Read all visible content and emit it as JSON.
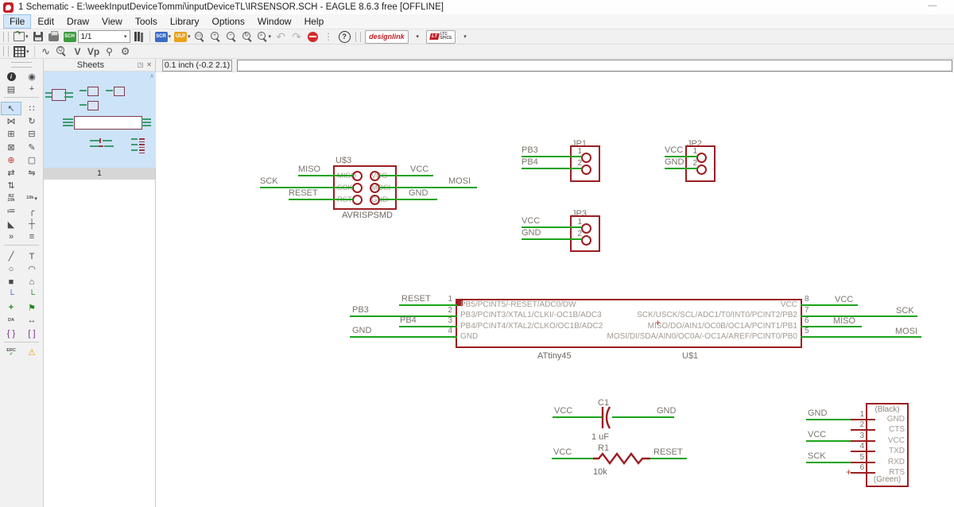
{
  "titlebar": {
    "title": "1 Schematic - E:\\weekInputDeviceTommi\\inputDeviceTL\\IRSENSOR.SCH - EAGLE 8.6.3 free [OFFLINE]",
    "minimize_glyph": "—"
  },
  "menubar": {
    "items": [
      "File",
      "Edit",
      "Draw",
      "View",
      "Tools",
      "Library",
      "Options",
      "Window",
      "Help"
    ],
    "active_item": "File"
  },
  "toolbar_main": {
    "page_selector": "1/1",
    "sch_badge": "SCH",
    "scr_badge": "SCR",
    "ulp_badge": "ULP",
    "help_glyph": "?",
    "designlink_label": "designlink",
    "ltspice_logo": "LT",
    "ltspice_line1": "LTC",
    "ltspice_line2": "SPICE"
  },
  "toolbar_view": {
    "v_label": "V",
    "vp_label": "Vp"
  },
  "sidebar_icons": {
    "value_tool_line1": "R2",
    "value_tool_line2": "10k",
    "smash_tool_label": "10k",
    "attribute_tool_label": "DA",
    "erc_label": "ERC",
    "text_tool_label": "T"
  },
  "sheets_panel": {
    "title": "Sheets",
    "sheet_number": "1"
  },
  "command_bar": {
    "coordinate": "0.1 inch (-0.2 2.1)",
    "command_value": ""
  },
  "schematic": {
    "parts": {
      "u3": {
        "name": "U$3",
        "value": "AVRISPSMD",
        "pin_labels_left": [
          "MISO",
          "SCK",
          "RST"
        ],
        "pin_labels_right": [
          "VCC",
          "MOSI",
          "GND"
        ],
        "nets_left": [
          "MISO",
          "SCK",
          "RESET"
        ],
        "nets_right": [
          "VCC",
          "MOSI",
          "GND"
        ]
      },
      "jp1": {
        "name": "JP1",
        "pin_numbers": [
          "1",
          "2"
        ],
        "nets": [
          "PB3",
          "PB4"
        ]
      },
      "jp2": {
        "name": "JP2",
        "pin_numbers": [
          "1",
          "2"
        ],
        "nets": [
          "VCC",
          "GND"
        ]
      },
      "jp3": {
        "name": "JP3",
        "pin_numbers": [
          "1",
          "2"
        ],
        "nets": [
          "VCC",
          "GND"
        ]
      },
      "u1": {
        "name": "U$1",
        "value": "ATtiny45",
        "left_pins": [
          {
            "number": "1",
            "net": "RESET",
            "label": "PB5/PCINT5/-RESET/ADC0/DW"
          },
          {
            "number": "2",
            "net": "PB3",
            "label": "PB3/PCINT3/XTAL1/CLKI/-OC1B/ADC3"
          },
          {
            "number": "3",
            "net": "PB4",
            "label": "PB4/PCINT4/XTAL2/CLKO/OC1B/ADC2"
          },
          {
            "number": "4",
            "net": "GND",
            "label": "GND"
          }
        ],
        "right_pins": [
          {
            "number": "8",
            "net": "VCC",
            "label": "VCC"
          },
          {
            "number": "7",
            "net": "SCK",
            "label": "SCK/USCK/SCL/ADC1/T0/INT0/PCINT2/PB2"
          },
          {
            "number": "6",
            "net": "MISO",
            "label": "MISO/DO/AIN1/OC0B/OC1A/PCINT1/PB1"
          },
          {
            "number": "5",
            "net": "MOSI",
            "label": "MOSI/DI/SDA/AIN0/OC0A/-OC1A/AREF/PCINT0/PB0"
          }
        ]
      },
      "c1": {
        "name": "C1",
        "value": "1 uF",
        "net_left": "VCC",
        "net_right": "GND"
      },
      "r1": {
        "name": "R1",
        "value": "10k",
        "net_left": "VCC",
        "net_right": "RESET"
      },
      "ftdi": {
        "top_label": "(Black)",
        "bottom_label": "(Green)",
        "pins": [
          {
            "number": "1",
            "label": "GND",
            "net": "GND"
          },
          {
            "number": "2",
            "label": "CTS",
            "net": ""
          },
          {
            "number": "3",
            "label": "VCC",
            "net": "VCC"
          },
          {
            "number": "4",
            "label": "TXD",
            "net": ""
          },
          {
            "number": "5",
            "label": "RXD",
            "net": "SCK"
          },
          {
            "number": "6",
            "label": "RTS",
            "net": ""
          }
        ]
      }
    },
    "colors": {
      "symbol": "#9c1e22",
      "wire": "#1aa31a",
      "net_label": "#7b746c",
      "pin_label": "#a39b93"
    }
  }
}
